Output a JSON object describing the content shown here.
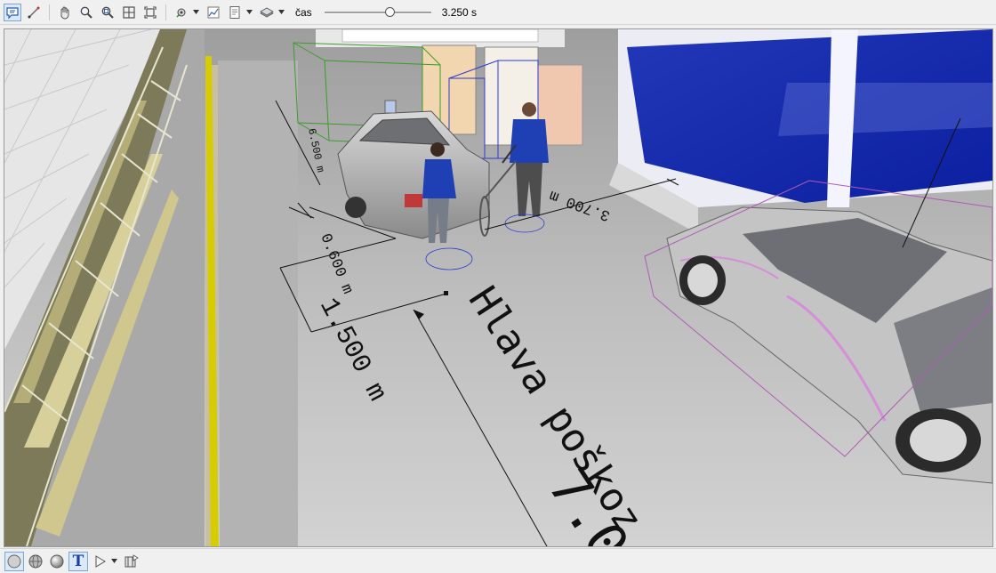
{
  "toolbar": {
    "tools_left": [
      {
        "name": "comment-icon",
        "active": true
      },
      {
        "name": "measure-line-icon"
      },
      {
        "name": "pan-hand-icon"
      },
      {
        "name": "zoom-icon"
      },
      {
        "name": "zoom-region-icon"
      },
      {
        "name": "zoom-fit-icon"
      },
      {
        "name": "zoom-extents-icon"
      }
    ],
    "time_label": "čas",
    "time_value": "3.250 s",
    "time_slider_fraction": 0.62
  },
  "scene": {
    "dimension_1": "1.500 m",
    "dimension_2": "0.600 m",
    "dimension_3": "3.700 m",
    "dimension_4": "6.500 m",
    "annotation_main": "Hlava poškoz",
    "annotation_digits": "7.0"
  },
  "bottom_toolbar": {
    "text_tool_label": "T"
  }
}
